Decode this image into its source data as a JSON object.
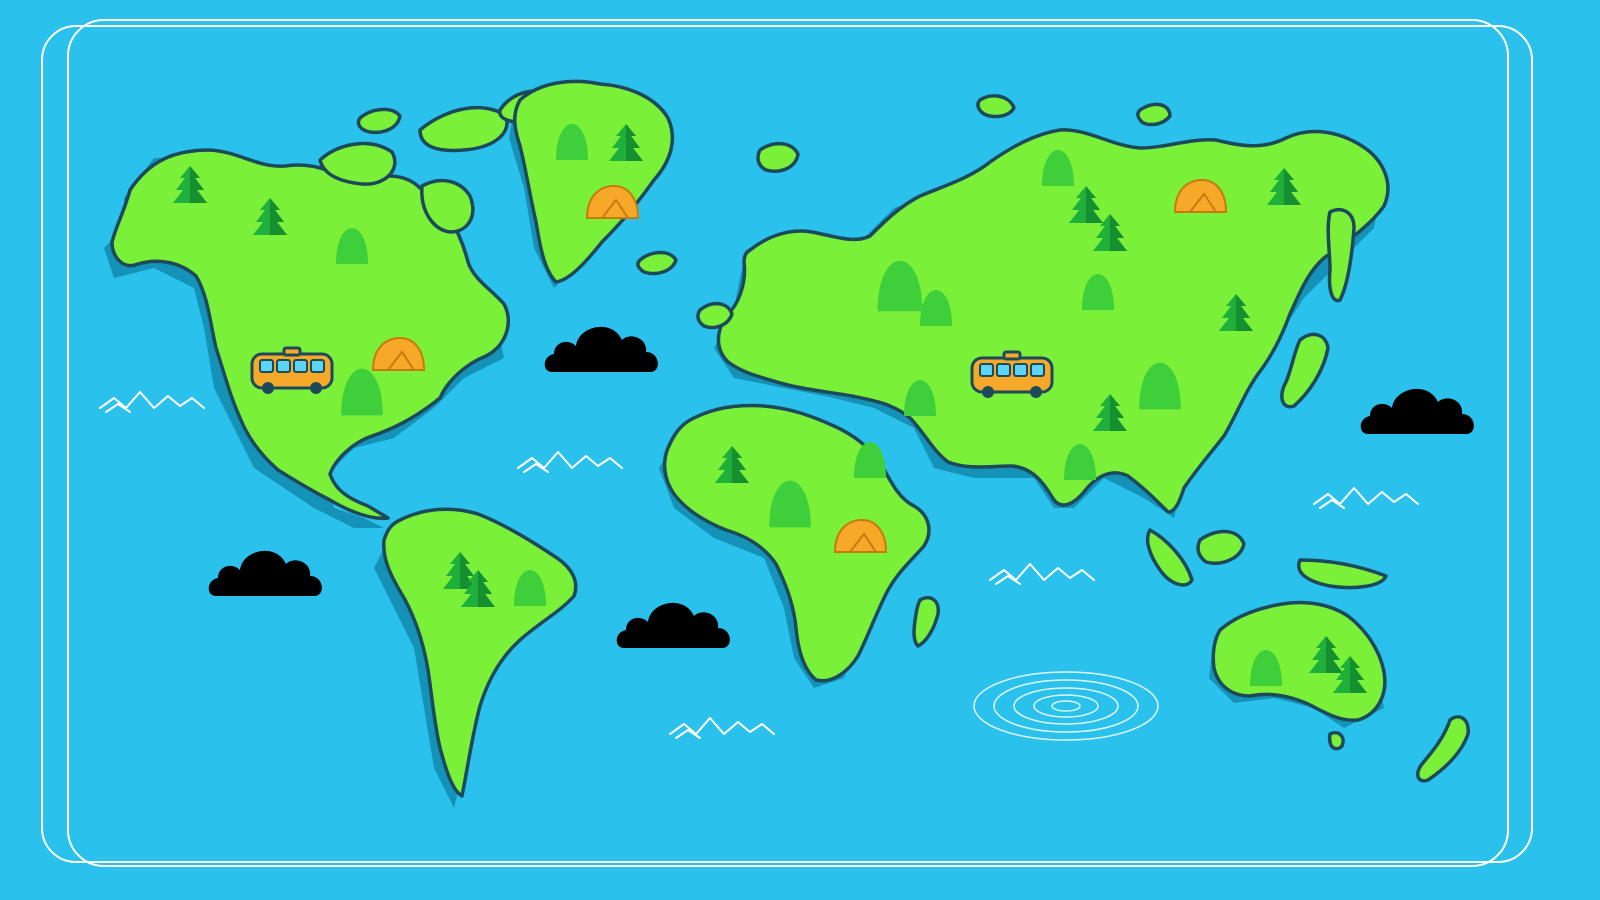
{
  "map": {
    "style": "illustrated world map",
    "colors": {
      "ocean": "#2ac1ec",
      "land": "#7af038",
      "coastline": "#1d4a5a",
      "tree": "#1fb03b",
      "tent": "#f6a929",
      "bus": "#f6a929",
      "cloud": "#ffffff",
      "frame": "#ffffff"
    },
    "continents": [
      "north-america",
      "greenland",
      "south-america",
      "europe-asia",
      "africa",
      "australia"
    ],
    "icons": [
      "tree-icon",
      "hill-icon",
      "tent-icon",
      "bus-icon",
      "cloud-icon",
      "wave-icon",
      "whirlpool-icon"
    ]
  }
}
